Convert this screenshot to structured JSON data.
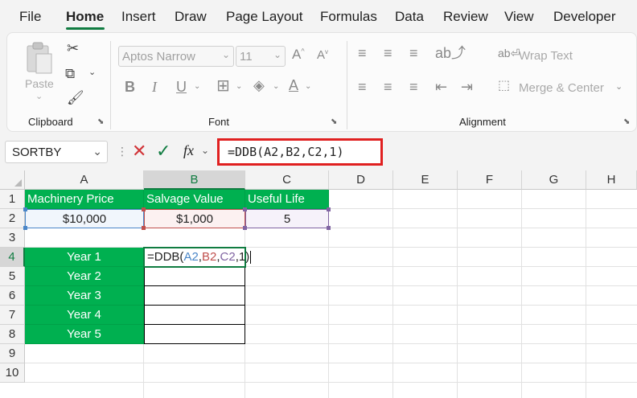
{
  "menu": {
    "tabs": [
      "File",
      "Home",
      "Insert",
      "Draw",
      "Page Layout",
      "Formulas",
      "Data",
      "Review",
      "View",
      "Developer"
    ],
    "active": "Home"
  },
  "ribbon": {
    "clipboard": {
      "label": "Clipboard",
      "paste_label": "Paste"
    },
    "font": {
      "label": "Font",
      "font_name": "Aptos Narrow",
      "font_size": "11"
    },
    "alignment": {
      "label": "Alignment",
      "wrap_text": "Wrap Text",
      "merge_center": "Merge & Center"
    }
  },
  "formula_bar": {
    "name_box": "SORTBY",
    "fx_label": "fx",
    "formula": "=DDB(A2,B2,C2,1)"
  },
  "columns": [
    "A",
    "B",
    "C",
    "D",
    "E",
    "F",
    "G",
    "H"
  ],
  "rows": [
    "1",
    "2",
    "3",
    "4",
    "5",
    "6",
    "7",
    "8",
    "9",
    "10"
  ],
  "cells": {
    "A1": "Machinery Price",
    "B1": "Salvage Value",
    "C1": "Useful Life",
    "A2": "$10,000",
    "B2": "$1,000",
    "C2": "5",
    "A4": "Year 1",
    "A5": "Year 2",
    "A6": "Year 3",
    "A7": "Year 4",
    "A8": "Year 5"
  },
  "editing": {
    "cell": "B4",
    "parts": [
      "=DDB(",
      "A2",
      ",",
      "B2",
      ",",
      "C2",
      ",1)"
    ]
  },
  "colors": {
    "accent": "#107c41",
    "header_fill": "#00b050",
    "ref_a2": "#4a86c8",
    "ref_b2": "#c0504d",
    "ref_c2": "#8064a2",
    "highlight_box": "#e02020"
  }
}
